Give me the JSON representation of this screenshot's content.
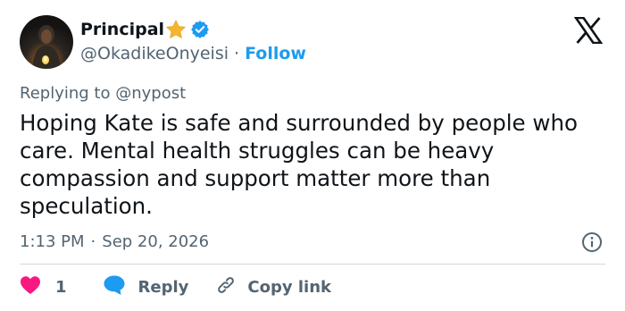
{
  "author": {
    "display_name": "Principal",
    "handle": "@OkadikeOnyeisi",
    "separator": "·",
    "follow_label": "Follow",
    "star_icon": "star-emoji-icon",
    "verified_icon": "verified-badge-icon"
  },
  "brand": {
    "logo": "x-logo-icon"
  },
  "reply_context": {
    "prefix": "Replying to",
    "mention": "@nypost"
  },
  "body": {
    "lines": [
      "Hoping Kate is safe and surrounded by people who",
      "care. Mental health struggles can be heavy",
      "compassion and support matter more than",
      "speculation."
    ]
  },
  "meta": {
    "time": "1:13 PM",
    "separator": "·",
    "date": "Sep 20, 2026",
    "info_icon": "info-icon"
  },
  "actions": {
    "like_count": "1",
    "reply_label": "Reply",
    "copy_label": "Copy link"
  },
  "colors": {
    "text": "#0f1419",
    "secondary": "#536471",
    "accent": "#1d9bf0",
    "like": "#f91880",
    "divider": "#cfd9de",
    "star": "#f5b52e"
  }
}
